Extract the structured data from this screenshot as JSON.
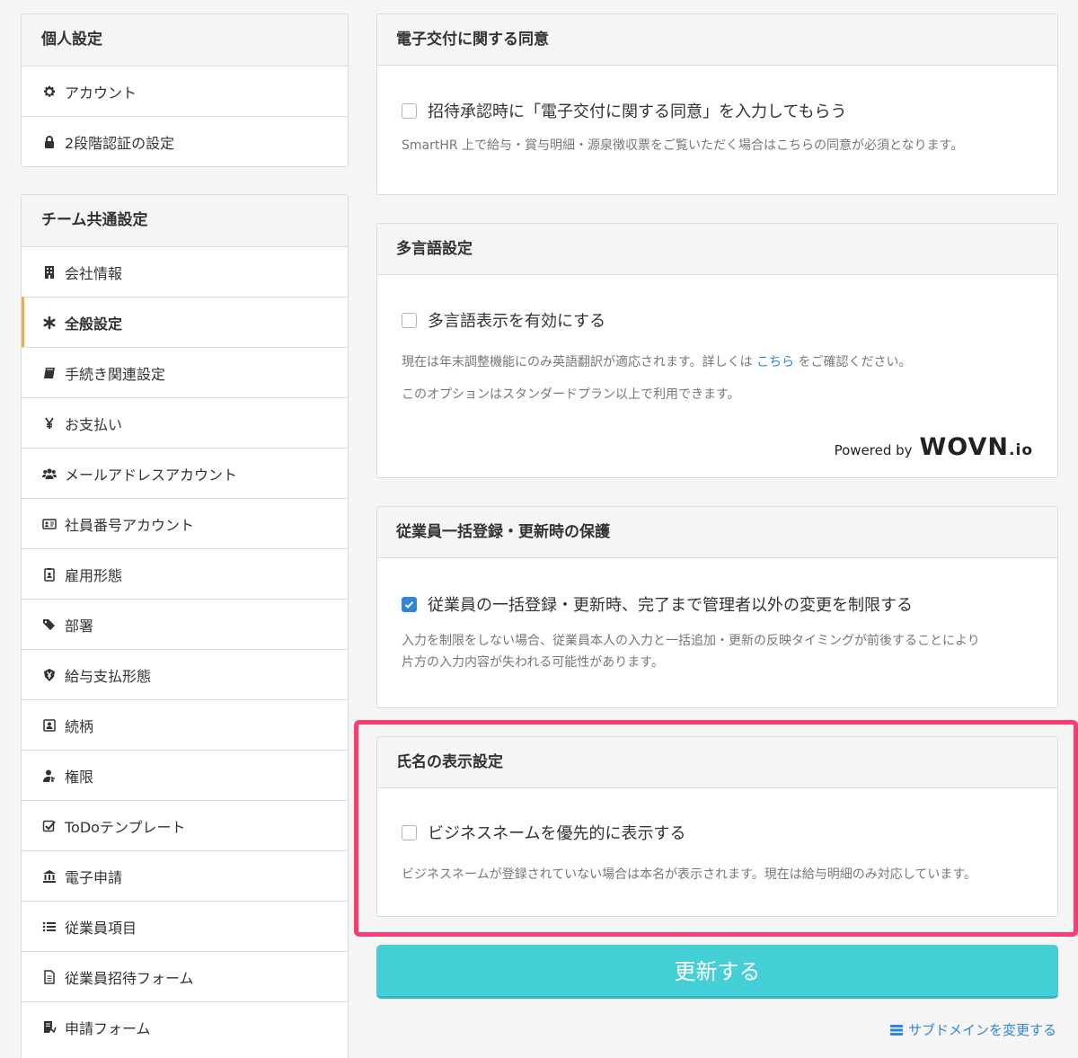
{
  "personal": {
    "title": "個人設定",
    "items": [
      {
        "label": "アカウント",
        "icon": "gear-icon"
      },
      {
        "label": "2段階認証の設定",
        "icon": "lock-icon"
      }
    ]
  },
  "team": {
    "title": "チーム共通設定",
    "items": [
      {
        "label": "会社情報",
        "icon": "building-icon"
      },
      {
        "label": "全般設定",
        "icon": "asterisk-icon",
        "active": true
      },
      {
        "label": "手続き関連設定",
        "icon": "book-icon"
      },
      {
        "label": "お支払い",
        "icon": "yen-icon"
      },
      {
        "label": "メールアドレスアカウント",
        "icon": "users-icon"
      },
      {
        "label": "社員番号アカウント",
        "icon": "id-card-icon"
      },
      {
        "label": "雇用形態",
        "icon": "badge-icon"
      },
      {
        "label": "部署",
        "icon": "tags-icon"
      },
      {
        "label": "給与支払形態",
        "icon": "yen-shield-icon"
      },
      {
        "label": "続柄",
        "icon": "contact-icon"
      },
      {
        "label": "権限",
        "icon": "user-key-icon"
      },
      {
        "label": "ToDoテンプレート",
        "icon": "checkbox-icon"
      },
      {
        "label": "電子申請",
        "icon": "bank-icon"
      },
      {
        "label": "従業員項目",
        "icon": "list-icon"
      },
      {
        "label": "従業員招待フォーム",
        "icon": "document-icon"
      },
      {
        "label": "申請フォーム",
        "icon": "form-icon"
      }
    ]
  },
  "panels": {
    "consent": {
      "title": "電子交付に関する同意",
      "checkbox_label": "招待承認時に「電子交付に関する同意」を入力してもらう",
      "checked": false,
      "help": "SmartHR 上で給与・賞与明細・源泉徴収票をご覧いただく場合はこちらの同意が必須となります。"
    },
    "multilang": {
      "title": "多言語設定",
      "checkbox_label": "多言語表示を有効にする",
      "checked": false,
      "help1_before": "現在は年末調整機能にのみ英語翻訳が適応されます。詳しくは",
      "help1_link": "こちら",
      "help1_after": "をご確認ください。",
      "help2": "このオプションはスタンダードプラン以上で利用できます。",
      "powered_by": "Powered by",
      "logo_main": "WOVN",
      "logo_suffix": ".io"
    },
    "bulk": {
      "title": "従業員一括登録・更新時の保護",
      "checkbox_label": "従業員の一括登録・更新時、完了まで管理者以外の変更を制限する",
      "checked": true,
      "help1": "入力を制限をしない場合、従業員本人の入力と一括追加・更新の反映タイミングが前後することにより",
      "help2": "片方の入力内容が失われる可能性があります。"
    },
    "name_display": {
      "title": "氏名の表示設定",
      "checkbox_label": "ビジネスネームを優先的に表示する",
      "checked": false,
      "help": "ビジネスネームが登録されていない場合は本名が表示されます。現在は給与明細のみ対応しています。"
    }
  },
  "submit_label": "更新する",
  "subdomain_link": "サブドメインを変更する",
  "colors": {
    "accent": "#45cfd6",
    "link": "#2f86d6",
    "highlight": "#ff3a75",
    "active_bar": "#f0ad4e"
  }
}
